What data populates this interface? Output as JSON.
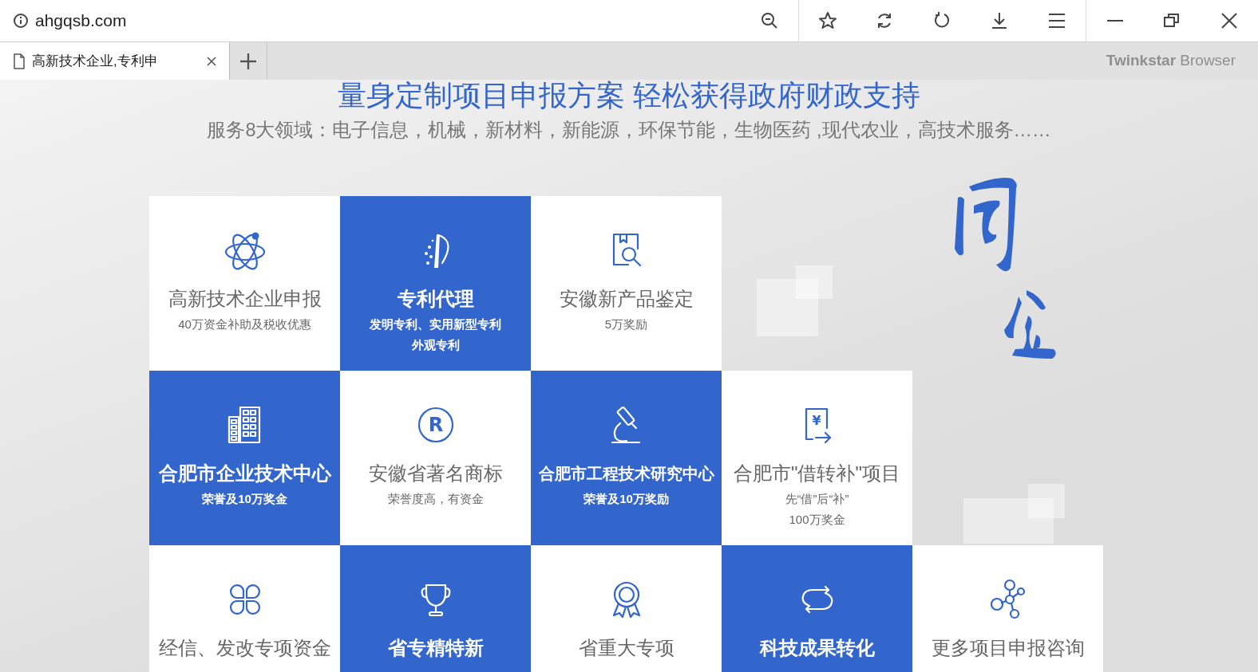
{
  "browser": {
    "address": "ahgqsb.com",
    "tab_title": "高新技术企业,专利申",
    "brand": "**Twinkstar** Browser"
  },
  "page": {
    "headline": "量身定制项目申报方案 轻松获得政府财政支持",
    "subheadline": "服务8大领域：电子信息，机械，新材料，新能源，环保节能，生物医药 ,现代农业，高技术服务……"
  },
  "tile_rows": [
    [
      {
        "title": "高新技术企业申报",
        "lines": [
          "40万资金补助及税收优惠"
        ],
        "highlighted": false
      },
      {
        "title": "专利代理",
        "lines": [
          "发明专利、实用新型专利",
          "外观专利"
        ],
        "highlighted": true
      },
      {
        "title": "安徽新产品鉴定",
        "lines": [
          "5万奖励"
        ],
        "highlighted": false
      }
    ],
    [
      {
        "title": "合肥市企业技术中心",
        "lines": [
          "荣誉及10万奖金"
        ],
        "highlighted": true
      },
      {
        "icon_label": "R",
        "title": "安徽省著名商标",
        "lines": [
          "荣誉度高，有资金"
        ],
        "highlighted": false
      },
      {
        "title": "合肥市工程技术研究中心",
        "lines": [
          "荣誉及10万奖励"
        ],
        "highlighted": true
      },
      {
        "icon_label": "¥",
        "title": "合肥市\"借转补\"项目",
        "lines": [
          "先“借”后“补”",
          "100万奖金"
        ],
        "highlighted": false
      }
    ],
    [
      {
        "title": "经信、发改专项资金",
        "highlighted": false
      },
      {
        "title": "省专精特新",
        "highlighted": true
      },
      {
        "title": "省重大专项",
        "highlighted": false
      },
      {
        "title": "科技成果转化",
        "highlighted": true
      },
      {
        "title": "更多项目申报咨询",
        "highlighted": false
      }
    ]
  ]
}
